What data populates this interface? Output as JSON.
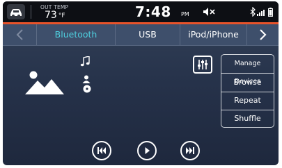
{
  "status": {
    "out_temp_label": "OUT TEMP",
    "out_temp_value": "73",
    "out_temp_unit": "°F",
    "clock_time": "7:48",
    "clock_ampm": "PM"
  },
  "tabs": [
    {
      "label": "Bluetooth",
      "active": true
    },
    {
      "label": "USB",
      "active": false
    },
    {
      "label": "iPod/iPhone",
      "active": false
    }
  ],
  "menu": {
    "manage_devices": "Manage Devices",
    "browse": "Browse",
    "repeat": "Repeat",
    "shuffle": "Shuffle"
  },
  "colors": {
    "accent": "#e8532a",
    "active_tab": "#4fd0e0",
    "background": "#26324a"
  },
  "icons": {
    "home": "car-home-icon",
    "mute": "mute-icon",
    "bluetooth": "bluetooth-icon",
    "signal": "signal-icon",
    "battery": "battery-icon",
    "eq": "equalizer-icon",
    "prev": "skip-previous-icon",
    "play": "play-icon",
    "next": "skip-next-icon"
  }
}
